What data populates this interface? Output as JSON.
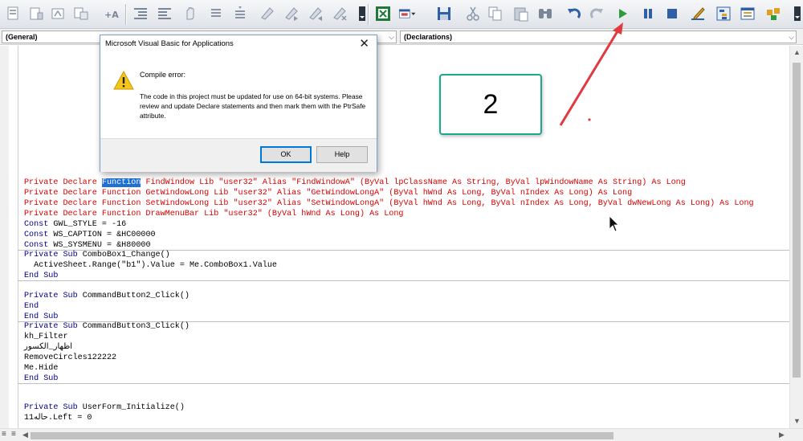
{
  "toolbar": {
    "icons": [
      "list-properties-icon",
      "list-constants-icon",
      "quick-info-icon",
      "parameter-info-icon",
      "complete-word-icon",
      "outdent-icon",
      "indent-icon",
      "toggle-breakpoint-icon",
      "comment-block-icon",
      "uncomment-block-icon",
      "toggle-bookmark-icon",
      "next-bookmark-icon",
      "previous-bookmark-icon",
      "clear-bookmarks-icon",
      "excel-icon",
      "insert-userform-icon",
      "save-icon",
      "cut-icon",
      "copy-icon",
      "paste-icon",
      "find-icon",
      "undo-icon",
      "redo-icon",
      "run-icon",
      "break-icon",
      "reset-icon",
      "design-mode-icon",
      "project-explorer-icon",
      "properties-window-icon",
      "object-browser-icon"
    ],
    "accent": "#2f9b3a"
  },
  "combos": {
    "object": "(General)",
    "procedure": "(Declarations)"
  },
  "code": {
    "lines": {
      "l1_pre": "Private Declare ",
      "l1_hl": "Function",
      "l1_post": " FindWindow Lib \"user32\" Alias \"FindWindowA\" (ByVal lpClassName As String, ByVal lpWindowName As String) As Long",
      "l2": "Private Declare Function GetWindowLong Lib \"user32\" Alias \"GetWindowLongA\" (ByVal hWnd As Long, ByVal nIndex As Long) As Long",
      "l3": "Private Declare Function SetWindowLong Lib \"user32\" Alias \"SetWindowLongA\" (ByVal hWnd As Long, ByVal nIndex As Long, ByVal dwNewLong As Long) As Long",
      "l4": "Private Declare Function DrawMenuBar Lib \"user32\" (ByVal hWnd As Long) As Long",
      "l5_kw": "Const",
      "l5": " GWL_STYLE = -16",
      "l6_kw": "Const",
      "l6": " WS_CAPTION = &HC00000",
      "l7_kw": "Const",
      "l7": " WS_SYSMENU = &H80000",
      "l8_kw": "Private Sub",
      "l8": " ComboBox1_Change()",
      "l9": "  ActiveSheet.Range(\"b1\").Value = Me.ComboBox1.Value",
      "l10": "End Sub",
      "l11_kw": "Private Sub",
      "l11": " CommandButton2_Click()",
      "l12": "End",
      "l13": "End Sub",
      "l14_kw": "Private Sub",
      "l14": " CommandButton3_Click()",
      "l15": "kh_Filter",
      "l16": "اظهار_الكسور",
      "l17": "RemoveCircles122222",
      "l18": "Me.Hide",
      "l19": "End Sub",
      "l20_kw": "Private Sub",
      "l20": " UserForm_Initialize()",
      "l21": "حاله11.Left = 0"
    }
  },
  "dialog": {
    "title": "Microsoft Visual Basic for Applications",
    "heading": "Compile error:",
    "message": "The code in this project must be updated for use on 64-bit systems.  Please review and update Declare statements and then mark them with the PtrSafe attribute.",
    "ok_label": "OK",
    "help_label": "Help",
    "close_glyph": "✕"
  },
  "annotation": {
    "label": "2",
    "color": "#e0393e",
    "box_color": "#19a98c"
  }
}
